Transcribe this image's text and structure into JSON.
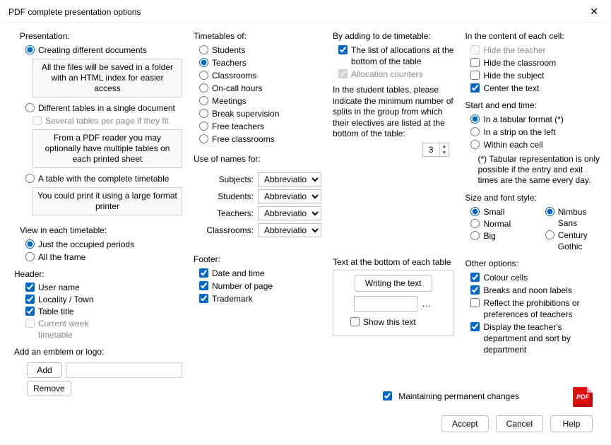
{
  "window": {
    "title": "PDF complete presentation options"
  },
  "presentation": {
    "title": "Presentation:",
    "opt1": "Creating different documents",
    "opt1_info": "All the files will be saved in a folder with an HTML index for easier access",
    "opt2": "Different tables in a single document",
    "opt2_sub": "Several tables per page if they fit",
    "opt2_info": "From a PDF reader you may optionally have multiple tables on each printed sheet",
    "opt3": "A table with the complete timetable",
    "opt3_info": "You could print it using a large format printer"
  },
  "view": {
    "title": "View in each timetable:",
    "opt1": "Just the occupied periods",
    "opt2": "All the frame"
  },
  "header": {
    "title": "Header:",
    "c1": "User name",
    "c2": "Locality / Town",
    "c3": "Table title",
    "c4": "Current week timetable"
  },
  "footer": {
    "title": "Footer:",
    "c1": "Date and time",
    "c2": "Number of page",
    "c3": "Trademark"
  },
  "emblem": {
    "title": "Add an emblem or logo:",
    "add": "Add",
    "remove": "Remove"
  },
  "timetables": {
    "title": "Timetables of:",
    "o1": "Students",
    "o2": "Teachers",
    "o3": "Classrooms",
    "o4": "On-call hours",
    "o5": "Meetings",
    "o6": "Break supervision",
    "o7": "Free teachers",
    "o8": "Free classrooms"
  },
  "names": {
    "title": "Use of names for:",
    "l1": "Subjects:",
    "l2": "Students:",
    "l3": "Teachers:",
    "l4": "Classrooms:",
    "val": "Abbreviation"
  },
  "adding": {
    "title": "By adding to de timetable:",
    "c1": "The list of allocations at the bottom of the table",
    "c2": "Allocation counters",
    "note": "In the student tables, please indicate the minimum number of splits in the group from which their electives are listed at the bottom of the table:",
    "spin": "3"
  },
  "bottomtext": {
    "title": "Text at the bottom of each table",
    "btn": "Writing the text",
    "show": "Show this text"
  },
  "cell": {
    "title": "In the content of each cell:",
    "c1": "Hide the teacher",
    "c2": "Hide the classroom",
    "c3": "Hide the subject",
    "c4": "Center the text"
  },
  "time": {
    "title": "Start and end time:",
    "o1": "In a tabular format (*)",
    "o2": "In a strip on the left",
    "o3": "Within each cell",
    "note": "(*) Tabular representation is only possible if the entry and exit times are the same every day."
  },
  "size": {
    "title": "Size and font style:",
    "s1": "Small",
    "s2": "Normal",
    "s3": "Big",
    "f1": "Nimbus Sans",
    "f2": "Century Gothic"
  },
  "other": {
    "title": "Other options:",
    "c1": "Colour cells",
    "c2": "Breaks and noon labels",
    "c3": "Reflect the prohibitions or preferences of teachers",
    "c4": "Display the teacher's department and sort by department"
  },
  "maintain": "Maintaining permanent changes",
  "buttons": {
    "accept": "Accept",
    "cancel": "Cancel",
    "help": "Help"
  }
}
